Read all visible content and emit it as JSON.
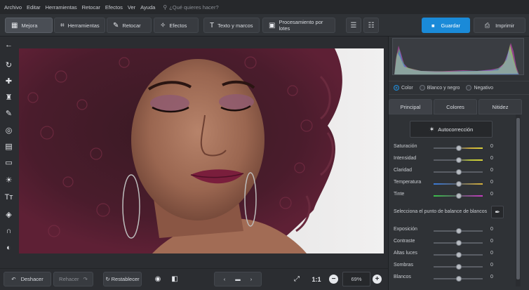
{
  "menu": {
    "items": [
      "Archivo",
      "Editar",
      "Herramientas",
      "Retocar",
      "Efectos",
      "Ver",
      "Ayuda"
    ],
    "search_placeholder": "¿Qué quieres hacer?"
  },
  "toolbar": {
    "tabs": [
      {
        "label": "Mejora",
        "icon": "mejora-icon"
      },
      {
        "label": "Herramientas",
        "icon": "crop-icon"
      },
      {
        "label": "Retocar",
        "icon": "brush-icon"
      },
      {
        "label": "Efectos",
        "icon": "magic-wand-icon"
      },
      {
        "label": "Texto y marcos",
        "icon": "text-icon"
      },
      {
        "label": "Procesamiento por lotes",
        "icon": "batch-image-icon"
      }
    ],
    "save_label": "Guardar",
    "print_label": "Imprimir"
  },
  "bottombar": {
    "undo_label": "Deshacer",
    "redo_label": "Rehacer",
    "restore_label": "Restablecer",
    "zoom_fit": "1:1",
    "zoom_value": "69%"
  },
  "panel": {
    "modes": [
      {
        "label": "Color",
        "selected": true
      },
      {
        "label": "Blanco y negro",
        "selected": false
      },
      {
        "label": "Negativo",
        "selected": false
      }
    ],
    "tabs": [
      "Principal",
      "Colores",
      "Nitidez"
    ],
    "autocorrection_label": "Autocorrección",
    "white_balance_label": "Selecciona el punto de balance de blancos",
    "sliders_top": [
      {
        "label": "Saturación",
        "value": "0"
      },
      {
        "label": "Intensidad",
        "value": "0"
      },
      {
        "label": "Claridad",
        "value": "0"
      },
      {
        "label": "Temperatura",
        "value": "0"
      },
      {
        "label": "Tinte",
        "value": "0"
      }
    ],
    "sliders_bottom": [
      {
        "label": "Exposición",
        "value": "0"
      },
      {
        "label": "Contraste",
        "value": "0"
      },
      {
        "label": "Altas luces",
        "value": "0"
      },
      {
        "label": "Sombras",
        "value": "0"
      },
      {
        "label": "Blancos",
        "value": "0"
      }
    ]
  },
  "colors": {
    "accent": "#1a8ad8",
    "background": "#2b2d31"
  }
}
